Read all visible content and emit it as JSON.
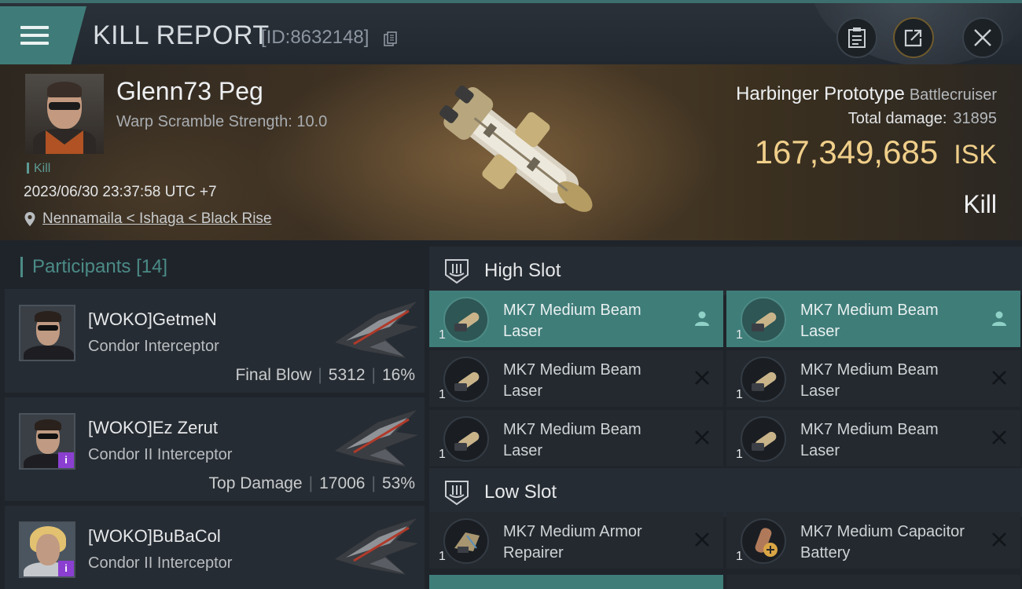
{
  "header": {
    "title": "KILL REPORT",
    "report_id": "[ID:8632148]",
    "icons": [
      "menu-icon",
      "copy-icon",
      "clipboard-icon",
      "share-icon",
      "close-icon"
    ]
  },
  "victim": {
    "name": "Glenn73 Peg",
    "warp_scramble": "Warp Scramble Strength: 10.0",
    "tag": "Kill",
    "datetime": "2023/06/30 23:37:58 UTC +7",
    "location": "Nennamaila < Ishaga < Black Rise",
    "ship_name": "Harbinger Prototype",
    "ship_class": "Battlecruiser",
    "total_damage_label": "Total damage:",
    "total_damage_value": "31895",
    "isk_value": "167,349,685",
    "isk_unit": "ISK",
    "result": "Kill"
  },
  "participants": {
    "title": "Participants",
    "count": "[14]",
    "rows": [
      {
        "name": "[WOKO]GetmeN",
        "ship": "Condor Interceptor",
        "stat_label": "Final Blow",
        "damage": "5312",
        "percent": "16%"
      },
      {
        "name": "[WOKO]Ez Zerut",
        "ship": "Condor II Interceptor",
        "stat_label": "Top Damage",
        "damage": "17006",
        "percent": "53%"
      },
      {
        "name": "[WOKO]BuBaCol",
        "ship": "Condor II Interceptor",
        "stat_label": "",
        "damage": "",
        "percent": ""
      }
    ]
  },
  "slots": {
    "high": {
      "label": "High Slot",
      "modules": [
        {
          "name": "MK7 Medium Beam Laser",
          "qty": "1",
          "state": "person-icon"
        },
        {
          "name": "MK7 Medium Beam Laser",
          "qty": "1",
          "state": "person-icon"
        },
        {
          "name": "MK7 Medium Beam Laser",
          "qty": "1",
          "state": "destroyed-x-icon"
        },
        {
          "name": "MK7 Medium Beam Laser",
          "qty": "1",
          "state": "destroyed-x-icon"
        },
        {
          "name": "MK7 Medium Beam Laser",
          "qty": "1",
          "state": "destroyed-x-icon"
        },
        {
          "name": "MK7 Medium Beam Laser",
          "qty": "1",
          "state": "destroyed-x-icon"
        }
      ]
    },
    "low": {
      "label": "Low Slot",
      "modules": [
        {
          "name": "MK7 Medium Armor Repairer",
          "qty": "1",
          "state": "destroyed-x-icon"
        },
        {
          "name": "MK7 Medium Capacitor Battery",
          "qty": "1",
          "state": "destroyed-x-icon"
        }
      ]
    }
  },
  "colors": {
    "accent_teal": "#3f7d79",
    "isk_gold": "#f0cf8a",
    "badge_purple": "#8a3fd1"
  }
}
